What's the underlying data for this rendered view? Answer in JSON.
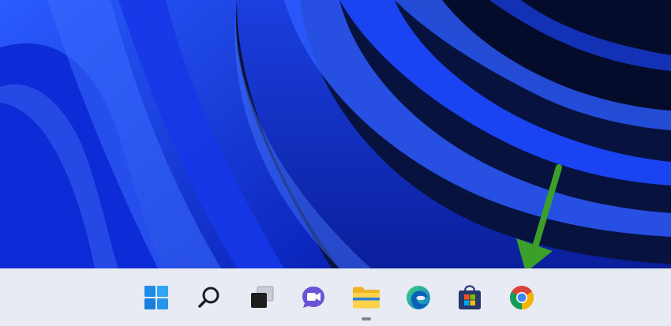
{
  "wallpaper": {
    "base_color": "#07123f",
    "accent_color": "#1f49ff",
    "highlight_color": "#4a7bff"
  },
  "annotation": {
    "arrow_color": "#3aa02a",
    "points_to": "chrome-taskbar-icon"
  },
  "taskbar": {
    "background": "#e8ebf3",
    "icons": [
      {
        "name": "windows-start-icon"
      },
      {
        "name": "search-icon"
      },
      {
        "name": "task-view-icon"
      },
      {
        "name": "teams-chat-icon"
      },
      {
        "name": "file-explorer-icon",
        "running": true
      },
      {
        "name": "edge-browser-icon"
      },
      {
        "name": "microsoft-store-icon"
      },
      {
        "name": "chrome-browser-icon"
      }
    ]
  }
}
